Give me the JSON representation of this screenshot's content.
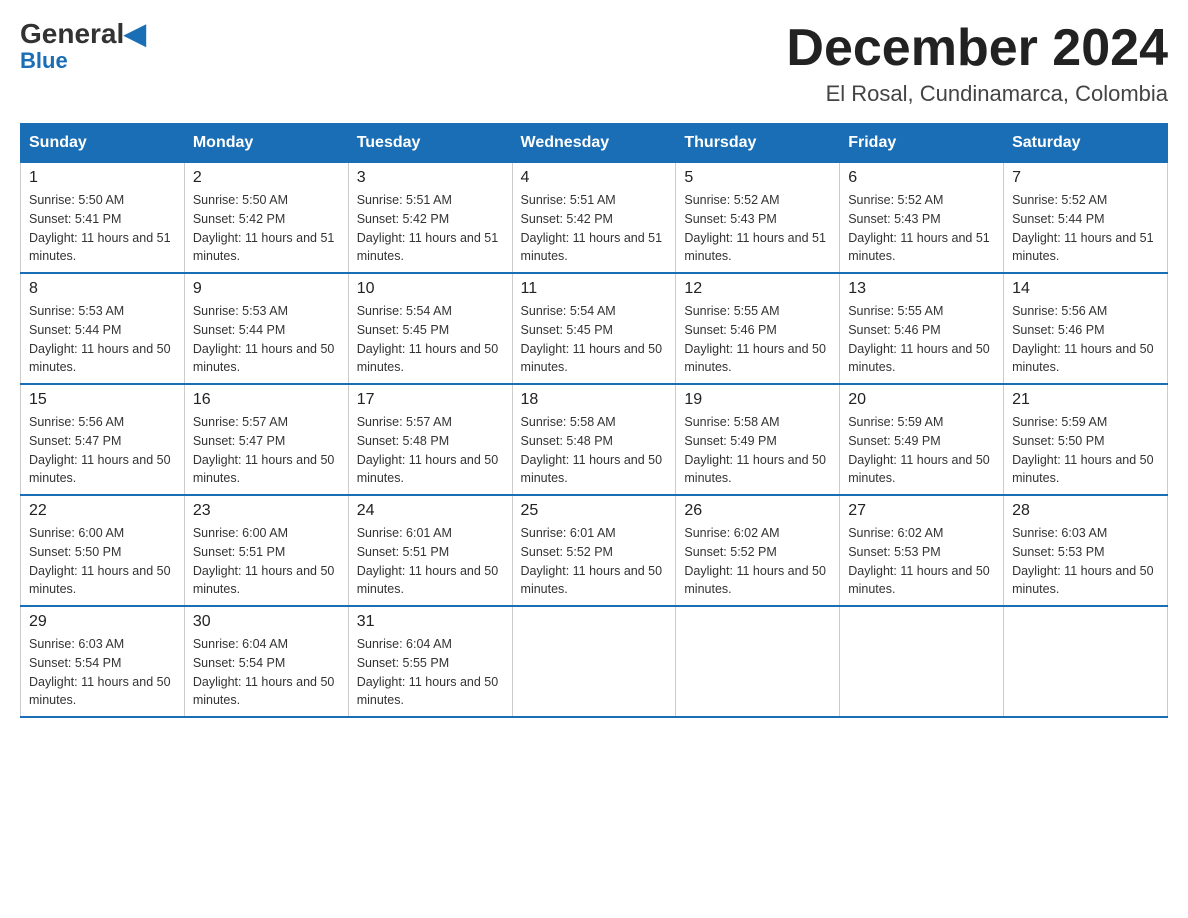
{
  "logo": {
    "line1a": "General",
    "line1b": "Blue",
    "line2": "Blue"
  },
  "header": {
    "month_year": "December 2024",
    "location": "El Rosal, Cundinamarca, Colombia"
  },
  "days_of_week": [
    "Sunday",
    "Monday",
    "Tuesday",
    "Wednesday",
    "Thursday",
    "Friday",
    "Saturday"
  ],
  "weeks": [
    [
      {
        "day": "1",
        "sunrise": "5:50 AM",
        "sunset": "5:41 PM",
        "daylight": "11 hours and 51 minutes."
      },
      {
        "day": "2",
        "sunrise": "5:50 AM",
        "sunset": "5:42 PM",
        "daylight": "11 hours and 51 minutes."
      },
      {
        "day": "3",
        "sunrise": "5:51 AM",
        "sunset": "5:42 PM",
        "daylight": "11 hours and 51 minutes."
      },
      {
        "day": "4",
        "sunrise": "5:51 AM",
        "sunset": "5:42 PM",
        "daylight": "11 hours and 51 minutes."
      },
      {
        "day": "5",
        "sunrise": "5:52 AM",
        "sunset": "5:43 PM",
        "daylight": "11 hours and 51 minutes."
      },
      {
        "day": "6",
        "sunrise": "5:52 AM",
        "sunset": "5:43 PM",
        "daylight": "11 hours and 51 minutes."
      },
      {
        "day": "7",
        "sunrise": "5:52 AM",
        "sunset": "5:44 PM",
        "daylight": "11 hours and 51 minutes."
      }
    ],
    [
      {
        "day": "8",
        "sunrise": "5:53 AM",
        "sunset": "5:44 PM",
        "daylight": "11 hours and 50 minutes."
      },
      {
        "day": "9",
        "sunrise": "5:53 AM",
        "sunset": "5:44 PM",
        "daylight": "11 hours and 50 minutes."
      },
      {
        "day": "10",
        "sunrise": "5:54 AM",
        "sunset": "5:45 PM",
        "daylight": "11 hours and 50 minutes."
      },
      {
        "day": "11",
        "sunrise": "5:54 AM",
        "sunset": "5:45 PM",
        "daylight": "11 hours and 50 minutes."
      },
      {
        "day": "12",
        "sunrise": "5:55 AM",
        "sunset": "5:46 PM",
        "daylight": "11 hours and 50 minutes."
      },
      {
        "day": "13",
        "sunrise": "5:55 AM",
        "sunset": "5:46 PM",
        "daylight": "11 hours and 50 minutes."
      },
      {
        "day": "14",
        "sunrise": "5:56 AM",
        "sunset": "5:46 PM",
        "daylight": "11 hours and 50 minutes."
      }
    ],
    [
      {
        "day": "15",
        "sunrise": "5:56 AM",
        "sunset": "5:47 PM",
        "daylight": "11 hours and 50 minutes."
      },
      {
        "day": "16",
        "sunrise": "5:57 AM",
        "sunset": "5:47 PM",
        "daylight": "11 hours and 50 minutes."
      },
      {
        "day": "17",
        "sunrise": "5:57 AM",
        "sunset": "5:48 PM",
        "daylight": "11 hours and 50 minutes."
      },
      {
        "day": "18",
        "sunrise": "5:58 AM",
        "sunset": "5:48 PM",
        "daylight": "11 hours and 50 minutes."
      },
      {
        "day": "19",
        "sunrise": "5:58 AM",
        "sunset": "5:49 PM",
        "daylight": "11 hours and 50 minutes."
      },
      {
        "day": "20",
        "sunrise": "5:59 AM",
        "sunset": "5:49 PM",
        "daylight": "11 hours and 50 minutes."
      },
      {
        "day": "21",
        "sunrise": "5:59 AM",
        "sunset": "5:50 PM",
        "daylight": "11 hours and 50 minutes."
      }
    ],
    [
      {
        "day": "22",
        "sunrise": "6:00 AM",
        "sunset": "5:50 PM",
        "daylight": "11 hours and 50 minutes."
      },
      {
        "day": "23",
        "sunrise": "6:00 AM",
        "sunset": "5:51 PM",
        "daylight": "11 hours and 50 minutes."
      },
      {
        "day": "24",
        "sunrise": "6:01 AM",
        "sunset": "5:51 PM",
        "daylight": "11 hours and 50 minutes."
      },
      {
        "day": "25",
        "sunrise": "6:01 AM",
        "sunset": "5:52 PM",
        "daylight": "11 hours and 50 minutes."
      },
      {
        "day": "26",
        "sunrise": "6:02 AM",
        "sunset": "5:52 PM",
        "daylight": "11 hours and 50 minutes."
      },
      {
        "day": "27",
        "sunrise": "6:02 AM",
        "sunset": "5:53 PM",
        "daylight": "11 hours and 50 minutes."
      },
      {
        "day": "28",
        "sunrise": "6:03 AM",
        "sunset": "5:53 PM",
        "daylight": "11 hours and 50 minutes."
      }
    ],
    [
      {
        "day": "29",
        "sunrise": "6:03 AM",
        "sunset": "5:54 PM",
        "daylight": "11 hours and 50 minutes."
      },
      {
        "day": "30",
        "sunrise": "6:04 AM",
        "sunset": "5:54 PM",
        "daylight": "11 hours and 50 minutes."
      },
      {
        "day": "31",
        "sunrise": "6:04 AM",
        "sunset": "5:55 PM",
        "daylight": "11 hours and 50 minutes."
      },
      null,
      null,
      null,
      null
    ]
  ]
}
